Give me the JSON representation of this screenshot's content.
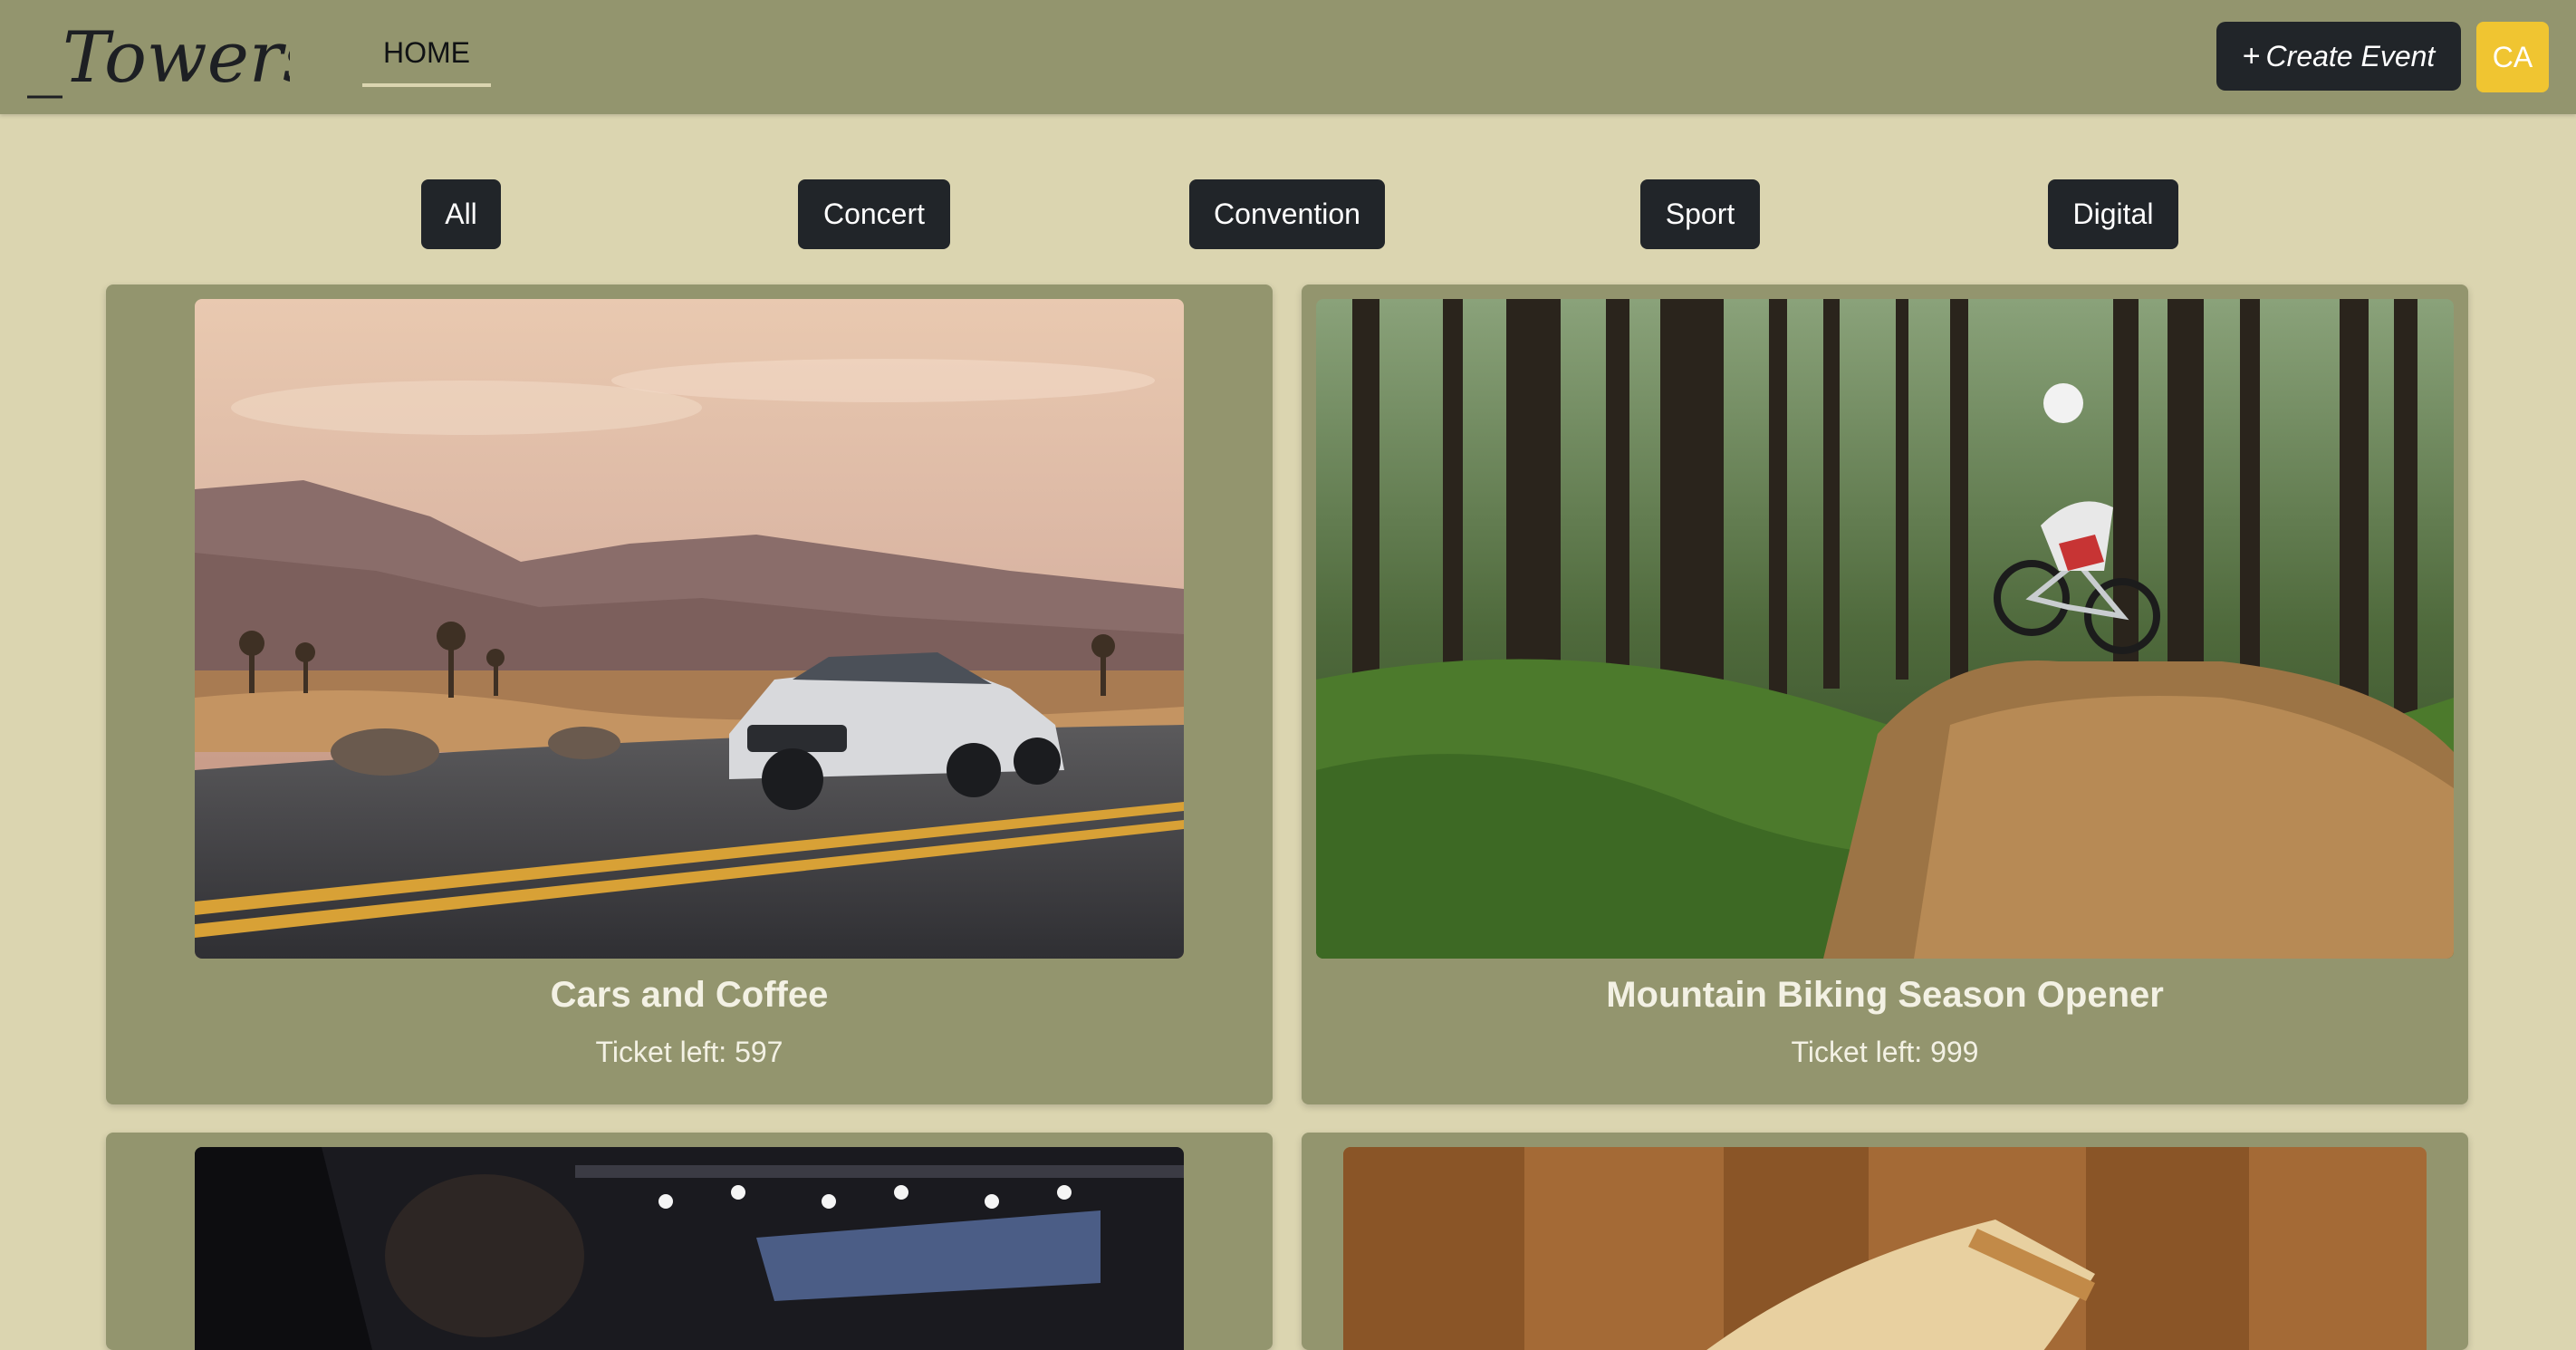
{
  "navbar": {
    "logo_text": "_Towers",
    "home_label": "HOME",
    "create_event_label": "Create Event",
    "create_event_icon": "plus-icon",
    "avatar_initials": "CA"
  },
  "filters": [
    {
      "label": "All"
    },
    {
      "label": "Concert"
    },
    {
      "label": "Convention"
    },
    {
      "label": "Sport"
    },
    {
      "label": "Digital"
    }
  ],
  "events": [
    {
      "title": "Cars and Coffee",
      "tickets_text": "Ticket left: 597",
      "image": "white sedan on desert road at sunset"
    },
    {
      "title": "Mountain Biking Season Opener",
      "tickets_text": "Ticket left: 999",
      "image": "mountain biker jumping in forest"
    },
    {
      "title": "",
      "tickets_text": "",
      "image": "esports arena with lights"
    },
    {
      "title": "",
      "tickets_text": "",
      "image": "grilled sandwich on wooden table"
    }
  ],
  "colors": {
    "page_bg": "#dbd5b0",
    "navbar_bg": "#93956e",
    "card_bg": "#93956e",
    "button_dark": "#212529",
    "avatar_bg": "#f0c531"
  }
}
